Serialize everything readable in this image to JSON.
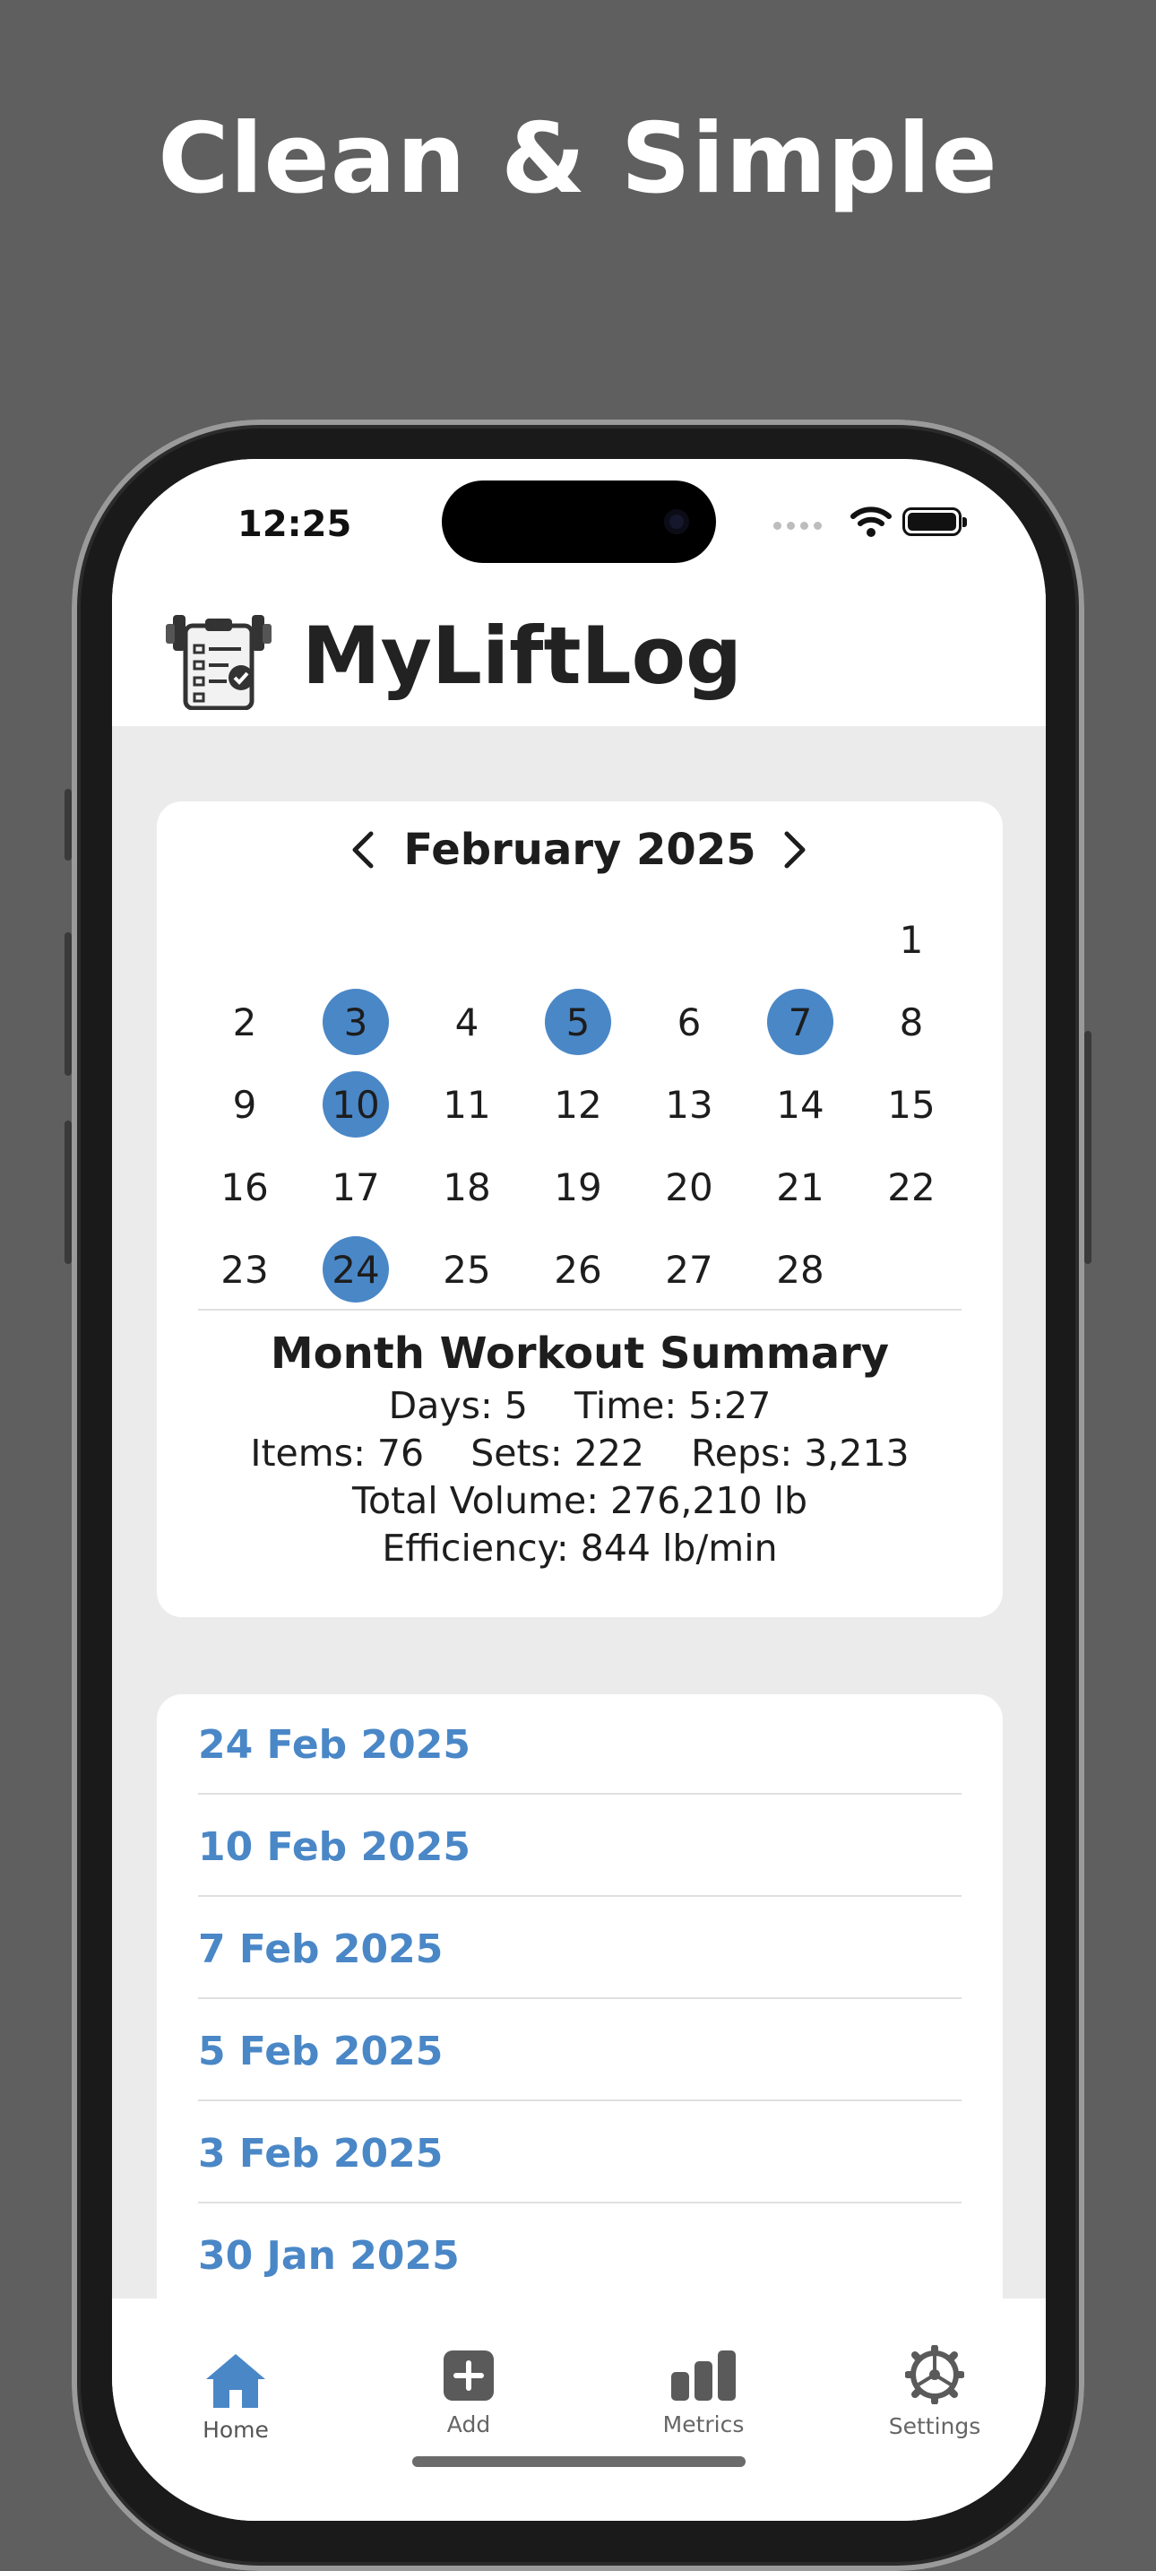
{
  "headline": "Clean & Simple",
  "status": {
    "time": "12:25"
  },
  "app": {
    "title": "MyLiftLog"
  },
  "calendar": {
    "month_label": "February 2025",
    "days": [
      {
        "d": "",
        "a": false
      },
      {
        "d": "",
        "a": false
      },
      {
        "d": "",
        "a": false
      },
      {
        "d": "",
        "a": false
      },
      {
        "d": "",
        "a": false
      },
      {
        "d": "",
        "a": false
      },
      {
        "d": "1",
        "a": false
      },
      {
        "d": "2",
        "a": false
      },
      {
        "d": "3",
        "a": true
      },
      {
        "d": "4",
        "a": false
      },
      {
        "d": "5",
        "a": true
      },
      {
        "d": "6",
        "a": false
      },
      {
        "d": "7",
        "a": true
      },
      {
        "d": "8",
        "a": false
      },
      {
        "d": "9",
        "a": false
      },
      {
        "d": "10",
        "a": true
      },
      {
        "d": "11",
        "a": false
      },
      {
        "d": "12",
        "a": false
      },
      {
        "d": "13",
        "a": false
      },
      {
        "d": "14",
        "a": false
      },
      {
        "d": "15",
        "a": false
      },
      {
        "d": "16",
        "a": false
      },
      {
        "d": "17",
        "a": false
      },
      {
        "d": "18",
        "a": false
      },
      {
        "d": "19",
        "a": false
      },
      {
        "d": "20",
        "a": false
      },
      {
        "d": "21",
        "a": false
      },
      {
        "d": "22",
        "a": false
      },
      {
        "d": "23",
        "a": false
      },
      {
        "d": "24",
        "a": true
      },
      {
        "d": "25",
        "a": false
      },
      {
        "d": "26",
        "a": false
      },
      {
        "d": "27",
        "a": false
      },
      {
        "d": "28",
        "a": false
      },
      {
        "d": "",
        "a": false
      }
    ],
    "highlight_color": "#4a87c7"
  },
  "summary": {
    "title": "Month Workout Summary",
    "line1": "Days: 5    Time: 5:27",
    "line2": "Items: 76    Sets: 222    Reps: 3,213",
    "line3": "Total Volume: 276,210 lb",
    "line4": "Efficiency: 844 lb/min"
  },
  "workouts": [
    "24 Feb 2025",
    "10 Feb 2025",
    "7 Feb 2025",
    "5 Feb 2025",
    "3 Feb 2025",
    "30 Jan 2025"
  ],
  "tabs": {
    "home": {
      "label": "Home",
      "icon": "house-icon",
      "color": "#4a87c7"
    },
    "add": {
      "label": "Add",
      "icon": "plus-square-icon"
    },
    "metrics": {
      "label": "Metrics",
      "icon": "bar-chart-icon"
    },
    "settings": {
      "label": "Settings",
      "icon": "gear-icon"
    }
  }
}
